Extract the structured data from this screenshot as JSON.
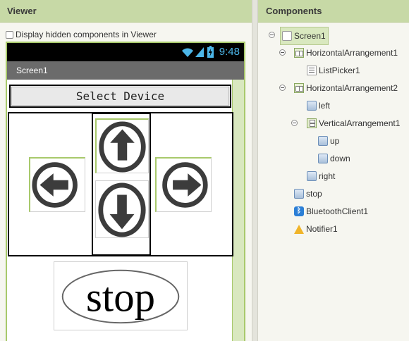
{
  "viewer": {
    "title": "Viewer",
    "checkbox_label": "Display hidden components in Viewer",
    "checkbox_checked": false,
    "phone": {
      "status_time": "9:48",
      "screen_title": "Screen1",
      "select_button_label": "Select Device",
      "stop_text": "stop"
    }
  },
  "components": {
    "title": "Components",
    "tree": [
      {
        "label": "Screen1",
        "icon": "screen-icon",
        "level": 0,
        "collapsible": true,
        "selected": true
      },
      {
        "label": "HorizontalArrangement1",
        "icon": "horizontal-arrangement-icon",
        "level": 1,
        "collapsible": true
      },
      {
        "label": "ListPicker1",
        "icon": "listpicker-icon",
        "level": 2,
        "collapsible": false
      },
      {
        "label": "HorizontalArrangement2",
        "icon": "horizontal-arrangement-icon",
        "level": 1,
        "collapsible": true
      },
      {
        "label": "left",
        "icon": "button-icon",
        "level": 2,
        "collapsible": false
      },
      {
        "label": "VerticalArrangement1",
        "icon": "vertical-arrangement-icon",
        "level": 2,
        "collapsible": true
      },
      {
        "label": "up",
        "icon": "button-icon",
        "level": 3,
        "collapsible": false
      },
      {
        "label": "down",
        "icon": "button-icon",
        "level": 3,
        "collapsible": false
      },
      {
        "label": "right",
        "icon": "button-icon",
        "level": 2,
        "collapsible": false
      },
      {
        "label": "stop",
        "icon": "button-icon",
        "level": 1,
        "collapsible": false
      },
      {
        "label": "BluetoothClient1",
        "icon": "bluetooth-icon",
        "level": 1,
        "collapsible": false
      },
      {
        "label": "Notifier1",
        "icon": "notifier-warning-icon",
        "level": 1,
        "collapsible": false
      }
    ]
  },
  "colors": {
    "panel_header": "#c7d9a6",
    "accent_green": "#a8c96b",
    "status_blue": "#4cb6e8",
    "title_bar": "#6b6b6b"
  }
}
